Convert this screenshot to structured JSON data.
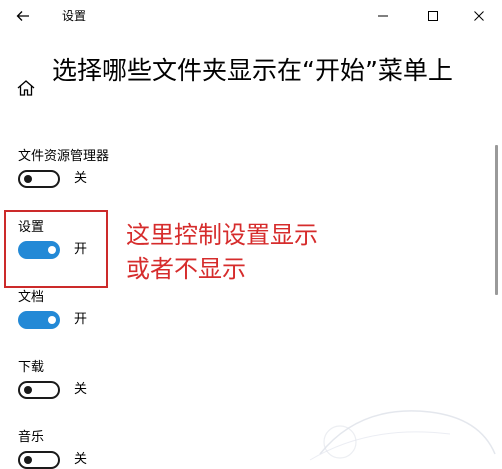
{
  "window": {
    "title": "设置"
  },
  "page": {
    "title": "选择哪些文件夹显示在“开始”菜单上"
  },
  "items": [
    {
      "label": "文件资源管理器",
      "state": "关",
      "on": false
    },
    {
      "label": "设置",
      "state": "开",
      "on": true
    },
    {
      "label": "文档",
      "state": "开",
      "on": true
    },
    {
      "label": "下载",
      "state": "关",
      "on": false
    },
    {
      "label": "音乐",
      "state": "关",
      "on": false
    }
  ],
  "annotation": {
    "line1": "这里控制设置显示",
    "line2": "或者不显示",
    "color": "#d62c2c"
  },
  "colors": {
    "toggle_on": "#2389d6",
    "toggle_off": "#1a1a1a",
    "highlight": "#cc2a2a"
  },
  "icons": {
    "back": "back-arrow-icon",
    "minimize": "minimize-icon",
    "maximize": "maximize-icon",
    "close": "close-icon",
    "home": "home-icon"
  }
}
